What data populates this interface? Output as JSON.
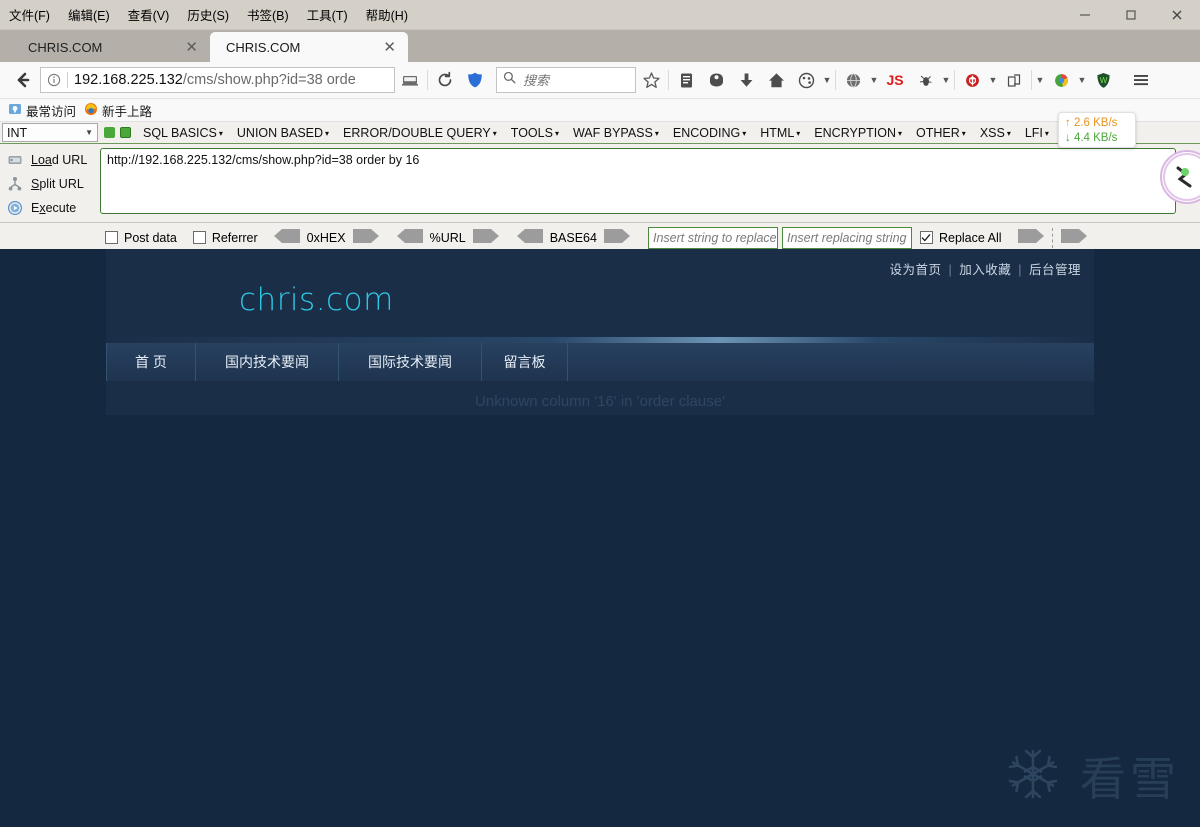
{
  "window": {
    "menu": [
      {
        "label": "文件(F)",
        "accel": "F"
      },
      {
        "label": "编辑(E)",
        "accel": "E"
      },
      {
        "label": "查看(V)",
        "accel": "V"
      },
      {
        "label": "历史(S)",
        "accel": "S"
      },
      {
        "label": "书签(B)",
        "accel": "B"
      },
      {
        "label": "工具(T)",
        "accel": "T"
      },
      {
        "label": "帮助(H)",
        "accel": "H"
      }
    ],
    "controls": {
      "minimize": "—",
      "maximize": "□",
      "close": "✕"
    }
  },
  "tabs": [
    {
      "title": "CHRIS.COM",
      "close": "✕",
      "active": false
    },
    {
      "title": "CHRIS.COM",
      "close": "✕",
      "active": true
    }
  ],
  "navbar": {
    "back_icon": "back-arrow-icon",
    "identity_icon": "page-info-icon",
    "url_host": "192.168.225.132",
    "url_path": "/cms/show.php?id=38 orde",
    "reader_icon": "reader-view-icon",
    "reload_icon": "reload-icon",
    "search_placeholder": "搜索",
    "icons": [
      "bookmark-star-icon",
      "library-icon",
      "pocket-icon",
      "downloads-icon",
      "home-icon",
      "palette-icon",
      "globe-icon",
      "javascript-toggle-icon",
      "bug-icon",
      "tamper-icon",
      "multitab-icon",
      "browser-icon",
      "adblock-shield-icon",
      "hamburger-menu-icon"
    ],
    "js_label": "JS",
    "shield_label": "W"
  },
  "bookmarks": [
    {
      "label": "最常访问",
      "icon": "most-visited-icon"
    },
    {
      "label": "新手上路",
      "icon": "firefox-getting-started-icon"
    }
  ],
  "network_monitor": {
    "upload": "↑ 2.6 KB/s",
    "download": "↓ 4.4 KB/s",
    "upload_color": "#e8921f",
    "download_color": "#4aa83a"
  },
  "hackbar": {
    "type_select": "INT",
    "menus": [
      "SQL BASICS",
      "UNION BASED",
      "ERROR/DOUBLE QUERY",
      "TOOLS",
      "WAF BYPASS",
      "ENCODING",
      "HTML",
      "ENCRYPTION",
      "OTHER",
      "XSS",
      "LFI"
    ],
    "actions": [
      {
        "label": "Load URL",
        "icon": "load-url-icon"
      },
      {
        "label": "Split URL",
        "icon": "split-url-icon"
      },
      {
        "label": "Execute",
        "icon": "execute-icon"
      }
    ],
    "url_value": "http://192.168.225.132/cms/show.php?id=38 order by 16",
    "post_data_label": "Post data",
    "post_data_checked": false,
    "referrer_label": "Referrer",
    "referrer_checked": false,
    "converters": [
      "0xHEX",
      "%URL",
      "BASE64"
    ],
    "replace_from_placeholder": "Insert string to replace",
    "replace_to_placeholder": "Insert replacing string",
    "replace_all_label": "Replace All",
    "replace_all_checked": true
  },
  "page": {
    "background": "#14283f",
    "site_background": "#1b2e47",
    "logo": "chris.com",
    "logo_color": "#2ec8e6",
    "top_links": [
      "设为首页",
      "加入收藏",
      "后台管理"
    ],
    "separator": "|",
    "nav": [
      "首 页",
      "国内技术要闻",
      "国际技术要闻",
      "留言板"
    ],
    "error_message": "Unknown column '16' in 'order clause'",
    "watermark_text": "看雪",
    "watermark_icon": "snowflake-icon"
  }
}
